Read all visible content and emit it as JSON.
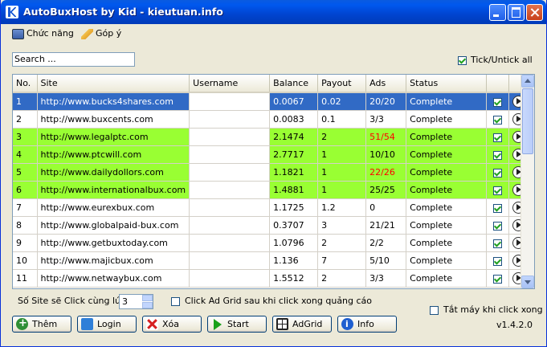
{
  "window": {
    "title": "AutoBuxHost by Kid - kieutuan.info"
  },
  "menu": {
    "functions": "Chức năng",
    "feedback": "Góp ý"
  },
  "search": {
    "value": "Search ..."
  },
  "tick_all": {
    "label": "Tick/Untick all",
    "checked": true
  },
  "table": {
    "columns": [
      "No.",
      "Site",
      "Username",
      "Balance",
      "Payout",
      "Ads",
      "Status"
    ],
    "rows": [
      {
        "no": "1",
        "site": "http://www.bucks4shares.com",
        "username": "",
        "balance": "0.0067",
        "payout": "0.02",
        "ads": "20/20",
        "status": "Complete",
        "style": "selected",
        "ads_red": false
      },
      {
        "no": "2",
        "site": "http://www.buxcents.com",
        "username": "",
        "balance": "0.0083",
        "payout": "0.1",
        "ads": "3/3",
        "status": "Complete",
        "style": "normal",
        "ads_red": false
      },
      {
        "no": "3",
        "site": "http://www.legalptc.com",
        "username": "",
        "balance": "2.1474",
        "payout": "2",
        "ads": "51/54",
        "status": "Complete",
        "style": "green",
        "ads_red": true
      },
      {
        "no": "4",
        "site": "http://www.ptcwill.com",
        "username": "",
        "balance": "2.7717",
        "payout": "1",
        "ads": "10/10",
        "status": "Complete",
        "style": "green",
        "ads_red": false
      },
      {
        "no": "5",
        "site": "http://www.dailydollors.com",
        "username": "",
        "balance": "1.1821",
        "payout": "1",
        "ads": "22/26",
        "status": "Complete",
        "style": "green",
        "ads_red": true
      },
      {
        "no": "6",
        "site": "http://www.internationalbux.com",
        "username": "",
        "balance": "1.4881",
        "payout": "1",
        "ads": "25/25",
        "status": "Complete",
        "style": "green",
        "ads_red": false
      },
      {
        "no": "7",
        "site": "http://www.eurexbux.com",
        "username": "",
        "balance": "1.1725",
        "payout": "1.2",
        "ads": "0",
        "status": "Complete",
        "style": "normal",
        "ads_red": false
      },
      {
        "no": "8",
        "site": "http://www.globalpaid-bux.com",
        "username": "",
        "balance": "0.3707",
        "payout": "3",
        "ads": "21/21",
        "status": "Complete",
        "style": "normal",
        "ads_red": false
      },
      {
        "no": "9",
        "site": "http://www.getbuxtoday.com",
        "username": "",
        "balance": "1.0796",
        "payout": "2",
        "ads": "2/2",
        "status": "Complete",
        "style": "normal",
        "ads_red": false
      },
      {
        "no": "10",
        "site": "http://www.majicbux.com",
        "username": "",
        "balance": "1.136",
        "payout": "7",
        "ads": "5/10",
        "status": "Complete",
        "style": "normal",
        "ads_red": false
      },
      {
        "no": "11",
        "site": "http://www.netwaybux.com",
        "username": "",
        "balance": "1.5512",
        "payout": "2",
        "ads": "3/3",
        "status": "Complete",
        "style": "normal",
        "ads_red": false
      }
    ]
  },
  "options": {
    "sites_label": "Số Site sẽ Click cùng lúc:",
    "sites_value": "3",
    "adgrid_label": "Click Ad Grid sau khi click xong quảng cáo",
    "shutdown_label": "Tắt máy khi click xong"
  },
  "buttons": {
    "add": "Thêm",
    "login": "Login",
    "delete": "Xóa",
    "start": "Start",
    "adgrid": "AdGrid",
    "info": "Info"
  },
  "version": "v1.4.2.0",
  "colors": {
    "selected_row": "#316ac5",
    "highlight_row": "#99ff33",
    "ads_warning": "#ff0000"
  }
}
